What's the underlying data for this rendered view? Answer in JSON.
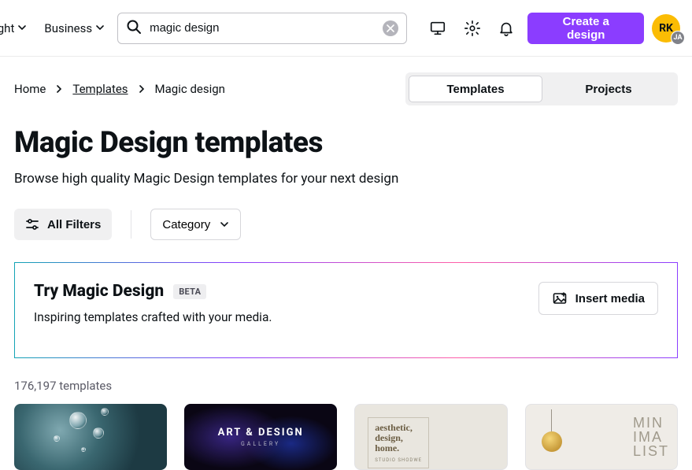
{
  "header": {
    "nav": {
      "spotlight": "otlight",
      "business": "Business"
    },
    "search": {
      "value": "magic design"
    },
    "cta": "Create a design",
    "avatar": {
      "initials": "RK",
      "badge": "JA"
    }
  },
  "breadcrumb": {
    "home": "Home",
    "templates": "Templates",
    "current": "Magic design"
  },
  "toggle": {
    "templates": "Templates",
    "projects": "Projects"
  },
  "page": {
    "title": "Magic Design templates",
    "subtitle": "Browse high quality Magic Design templates for your next design"
  },
  "filters": {
    "all": "All Filters",
    "category": "Category"
  },
  "magic": {
    "title": "Try Magic Design",
    "badge": "BETA",
    "subtitle": "Inspiring templates crafted with your media.",
    "insert": "Insert media"
  },
  "results": {
    "count": "176,197 templates"
  },
  "cards": {
    "c2": {
      "title": "ART & DESIGN",
      "sub": "GALLERY"
    },
    "c3": {
      "l1": "aesthetic,",
      "l2": "design,",
      "l3": "home.",
      "sub": "STUDIO SHODWE"
    },
    "c4": {
      "l1": "MIN",
      "l2": "IMA",
      "l3": "LIST"
    }
  }
}
